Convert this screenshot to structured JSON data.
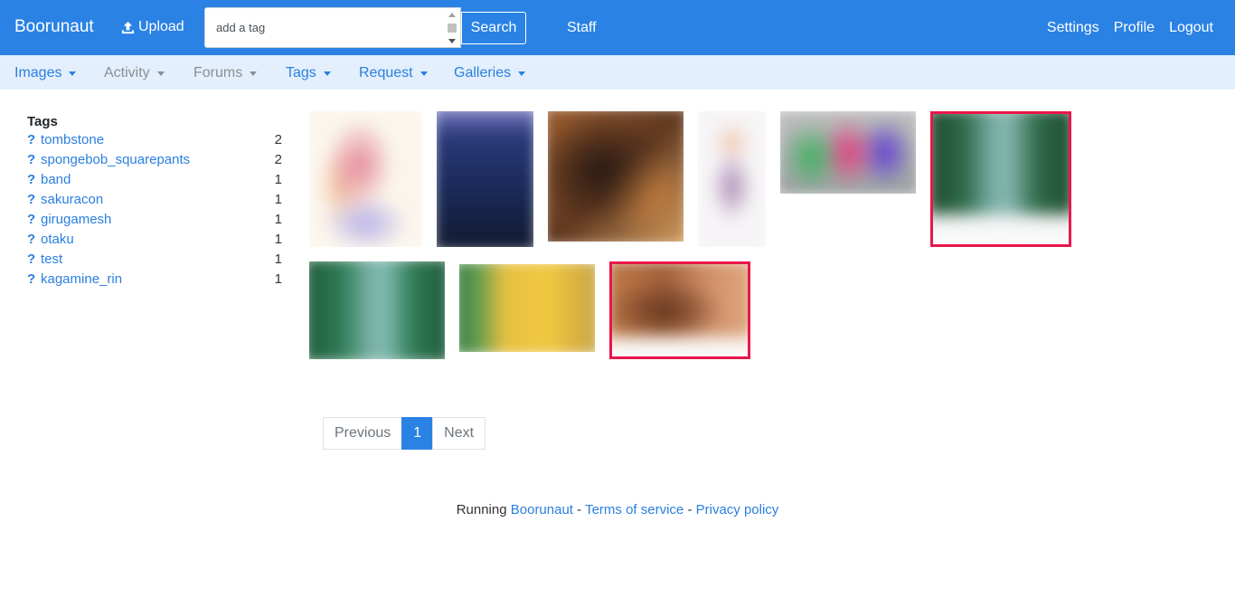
{
  "header": {
    "brand": "Boorunaut",
    "upload_label": "Upload",
    "search_placeholder": "add a tag",
    "search_button": "Search",
    "staff_label": "Staff",
    "right_links": [
      "Settings",
      "Profile",
      "Logout"
    ]
  },
  "subnav": {
    "items": [
      {
        "label": "Images",
        "state": "active"
      },
      {
        "label": "Activity",
        "state": "muted"
      },
      {
        "label": "Forums",
        "state": "muted"
      },
      {
        "label": "Tags",
        "state": "active"
      },
      {
        "label": "Request",
        "state": "active"
      },
      {
        "label": "Galleries",
        "state": "active"
      }
    ]
  },
  "sidebar": {
    "title": "Tags",
    "tags": [
      {
        "name": "tombstone",
        "count": "2"
      },
      {
        "name": "spongebob_squarepants",
        "count": "2"
      },
      {
        "name": "band",
        "count": "1"
      },
      {
        "name": "sakuracon",
        "count": "1"
      },
      {
        "name": "girugamesh",
        "count": "1"
      },
      {
        "name": "otaku",
        "count": "1"
      },
      {
        "name": "test",
        "count": "1"
      },
      {
        "name": "kagamine_rin",
        "count": "1"
      }
    ]
  },
  "pagination": {
    "previous": "Previous",
    "current": "1",
    "next": "Next"
  },
  "footer": {
    "prefix": "Running",
    "brand_link": "Boorunaut",
    "sep1": "-",
    "tos_link": "Terms of service",
    "sep2": "-",
    "privacy_link": "Privacy policy"
  },
  "colors": {
    "navbar": "#2a82e4",
    "subnav": "#e3effc",
    "link": "#2a7fe0",
    "highlight_border": "#e8174a"
  }
}
